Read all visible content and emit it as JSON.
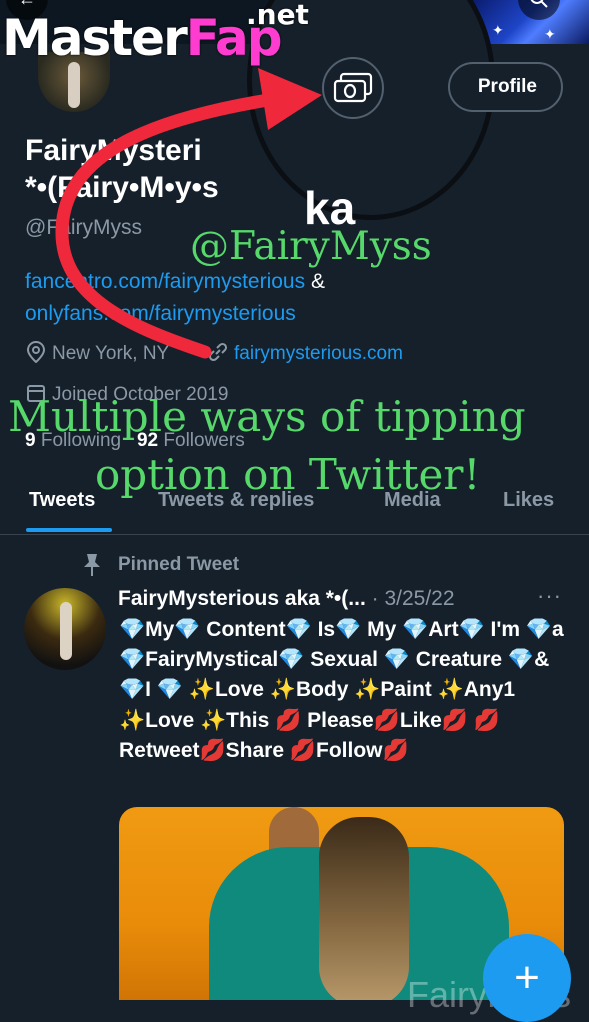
{
  "watermark": {
    "logo_master": "Master",
    "logo_fap": "Fap",
    "logo_net": ".net",
    "bottom_text": "FairyMyss"
  },
  "profile": {
    "name_line1": "FairyMysteri",
    "name_line2": "*•(Fairy•M•y•s",
    "name_overflow": "ka",
    "handle": "@FairyMyss",
    "bio_link1": "fancentro.com/fairymysterious",
    "bio_amp": " & ",
    "bio_link2": "onlyfans.com/fairymysterious",
    "location": "New York, NY",
    "website": "fairymysterious.com",
    "joined": "Joined October 2019",
    "following_count": "9",
    "following_label": "Following",
    "followers_count": "92",
    "followers_label": "Followers",
    "profile_button": "Profile"
  },
  "overlay": {
    "handle_caption": "@FairyMyss",
    "tip_line1": "Multiple ways of tipping",
    "tip_line2": "option on Twitter!"
  },
  "tabs": [
    "Tweets",
    "Tweets & replies",
    "Media",
    "Likes"
  ],
  "tweet": {
    "pinned_label": "Pinned Tweet",
    "author": "FairyMysterious aka *•(...",
    "date": "· 3/25/22",
    "more": "···",
    "body": "💎My💎 Content💎 Is💎 My 💎Art💎 I'm 💎a 💎FairyMystical💎 Sexual 💎 Creature 💎& 💎I 💎 ✨Love ✨Body ✨Paint ✨Any1 ✨Love ✨This 💋 Please💋Like💋 💋Retweet💋Share 💋Follow💋"
  },
  "colors": {
    "background": "#15202b",
    "link": "#1d9bf0",
    "muted": "#8b98a5",
    "overlay_green": "#56d86a",
    "arrow_red": "#f0283c"
  },
  "icons": {
    "back": "back-arrow-icon",
    "search": "search-icon",
    "tip": "money-tip-icon",
    "location": "location-pin-icon",
    "link": "link-icon",
    "calendar": "calendar-icon",
    "pin": "pin-icon",
    "compose": "plus-icon"
  },
  "fab_symbol": "+"
}
